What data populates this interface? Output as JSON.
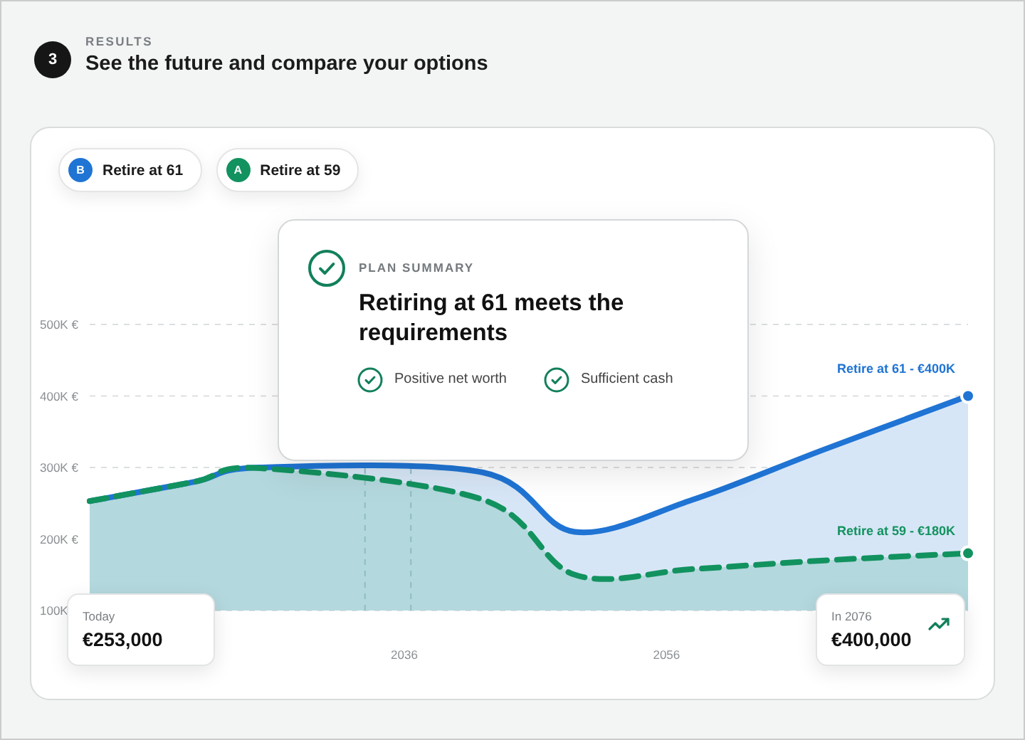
{
  "step": {
    "number": "3",
    "eyebrow": "RESULTS",
    "title": "See the future and compare your options"
  },
  "chart_card": {
    "legend": [
      {
        "badge": "B"
      },
      {
        "badge": "A"
      }
    ],
    "summary": {
      "eyebrow": "PLAN SUMMARY",
      "title": "Retiring at 61 meets the requirements",
      "checks": [
        "Positive net worth",
        "Sufficient cash"
      ]
    },
    "chart_data": {
      "type": "area",
      "x": [
        2012,
        2020,
        2025,
        2042,
        2049,
        2058,
        2068,
        2079
      ],
      "series": [
        {
          "name": "Retire at 61",
          "color": "#1f74d4",
          "values": [
            253,
            280,
            300,
            293,
            210,
            255,
            325,
            400
          ]
        },
        {
          "name": "Retire at 59",
          "color": "#12925f",
          "values": [
            253,
            280,
            299,
            255,
            150,
            158,
            170,
            180
          ]
        }
      ],
      "xlim": [
        2012,
        2079
      ],
      "ylim": [
        100,
        500
      ],
      "xticks": [
        2036,
        2056
      ],
      "ref_lines": [
        {
          "axis": "x",
          "value": 2033
        },
        {
          "axis": "x",
          "value": 2036.5
        }
      ],
      "yticks": [
        {
          "value": 100,
          "label": "100K"
        },
        {
          "value": 200,
          "label": "200K €"
        },
        {
          "value": 300,
          "label": "300K €"
        },
        {
          "value": 400,
          "label": "400K €"
        },
        {
          "value": 500,
          "label": "500K €"
        }
      ]
    },
    "end_labels": [
      {
        "text": "Retire at 61 - €400K",
        "color": "#1f74d4"
      },
      {
        "text": "Retire at 59 - €180K",
        "color": "#12925f"
      }
    ],
    "start_value": {
      "label": "Today",
      "value": "€253,000"
    },
    "end_value": {
      "label": "In 2076",
      "value": "€400,000"
    }
  }
}
